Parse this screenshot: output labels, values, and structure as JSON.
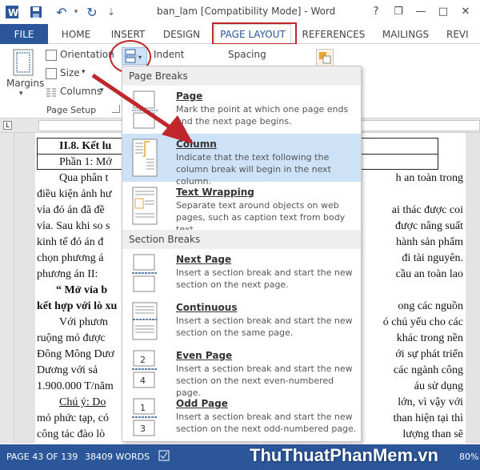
{
  "window": {
    "title": "ban_lam [Compatibility Mode] - Word",
    "controls": [
      "?",
      "—",
      "❐",
      "✕"
    ]
  },
  "quick_access": [
    "save-icon",
    "undo-icon",
    "redo-icon"
  ],
  "tabs": [
    {
      "label": "FILE"
    },
    {
      "label": "HOME"
    },
    {
      "label": "INSERT"
    },
    {
      "label": "DESIGN"
    },
    {
      "label": "PAGE LAYOUT"
    },
    {
      "label": "REFERENCES"
    },
    {
      "label": "MAILINGS"
    },
    {
      "label": "REVI"
    }
  ],
  "ribbon": {
    "margins": "Margins",
    "orientation": "Orientation",
    "size": "Size",
    "columns": "Columns",
    "indent": "Indent",
    "spacing": "Spacing",
    "group": "Page Setup"
  },
  "menu": {
    "page_breaks_header": "Page Breaks",
    "section_breaks_header": "Section Breaks",
    "items": [
      {
        "title": "Page",
        "desc": "Mark the point at which one page ends and the next page begins."
      },
      {
        "title": "Column",
        "desc": "Indicate that the text following the column break will begin in the next column."
      },
      {
        "title": "Text Wrapping",
        "desc": "Separate text around objects on web pages, such as caption text from body text."
      },
      {
        "title": "Next Page",
        "desc": "Insert a section break and start the new section on the next page."
      },
      {
        "title": "Continuous",
        "desc": "Insert a section break and start the new section on the same page."
      },
      {
        "title": "Even Page",
        "desc": "Insert a section break and start the new section on the next even-numbered page."
      },
      {
        "title": "Odd Page",
        "desc": "Insert a section break and start the new section on the next odd-numbered page."
      }
    ]
  },
  "document": {
    "left_lines": [
      "II.8. Kết lu",
      "Phần 1: Mở",
      "Qua phân t",
      "điều kiện ảnh hư",
      "vỉa đó án đã đề",
      "vỉa. Sau khi so s",
      "kinh tế đó án đ",
      "chọn phương á",
      "phương án II:",
      "“ Mở vỉa b",
      "kết hợp với lò xu",
      "Với phươn",
      "ruộng mỏ được",
      "Đông Mông Dươ",
      "Dương với sả",
      "1.900.000 T/năm",
      "Chú ý: Do",
      "mỏ phức tạp, có",
      "công tác đào lò"
    ],
    "right_lines": [
      "h an toàn trong",
      "ai thác được coi",
      "được nâng suất",
      "hành sản phẩm",
      "đi tài nguyên.",
      "cầu an toàn lao",
      "ong các nguồn",
      "ó chủ yếu cho các",
      "khác trong nền",
      "ới sự phát triển",
      "các ngành công",
      "áu sử dụng",
      "lớn, vì vậy với",
      "than hiện tại thì",
      "lượng than sẽ"
    ]
  },
  "status": {
    "page": "PAGE 43 OF 139",
    "words": "38409 WORDS",
    "zoom": "80%"
  },
  "watermark": "ThuThuatPhanMem.vn",
  "colors": {
    "accent": "#2b579a",
    "highlight": "#cde2f6",
    "annotation": "#c0272d"
  }
}
